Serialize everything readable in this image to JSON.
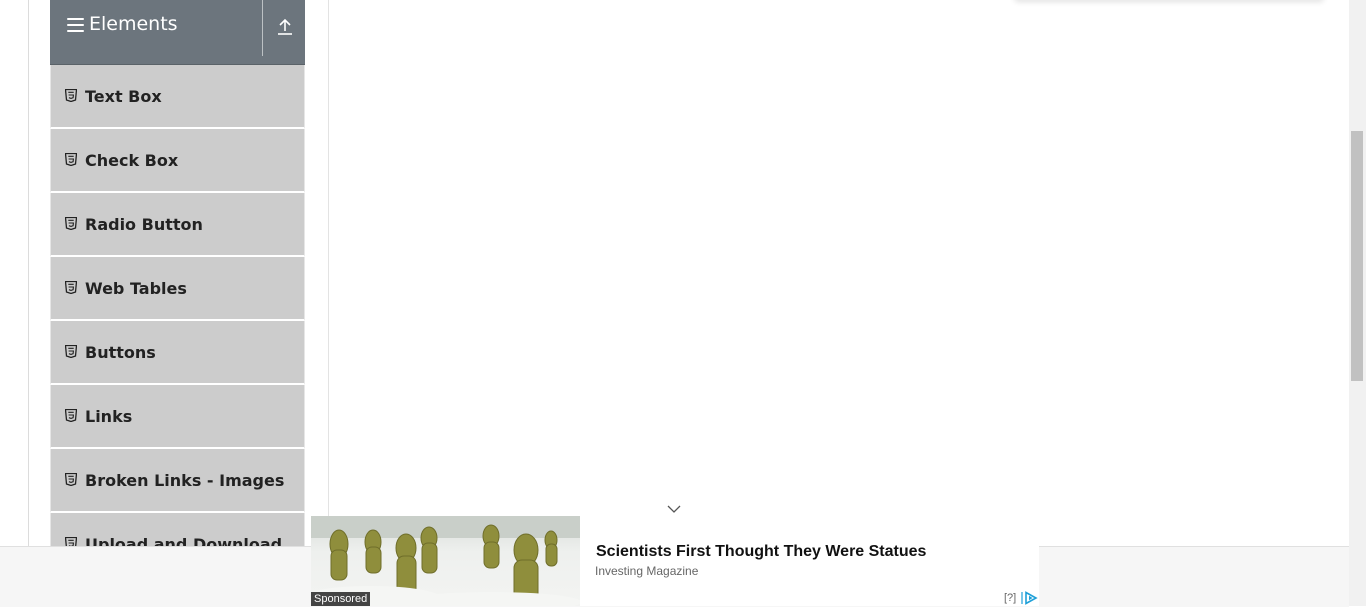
{
  "sidebar": {
    "group_title": "Elements",
    "items": [
      {
        "label": "Text Box"
      },
      {
        "label": "Check Box"
      },
      {
        "label": "Radio Button"
      },
      {
        "label": "Web Tables"
      },
      {
        "label": "Buttons"
      },
      {
        "label": "Links"
      },
      {
        "label": "Broken Links - Images"
      },
      {
        "label": "Upload and Download"
      }
    ]
  },
  "ad": {
    "headline": "Scientists First Thought They Were Statues",
    "source": "Investing Magazine",
    "sponsored_label": "Sponsored",
    "help_label": "[?]"
  },
  "colors": {
    "group_header": "#6c757d",
    "menu_item": "#cccccc",
    "ad_logo": "#1fa0d8"
  },
  "icons": {
    "group": "hamburger-menu-icon",
    "collapse": "upload-arrow-icon",
    "item": "html5-icon",
    "ad_expand": "chevron-down-icon",
    "ad_logo": "adchoices-icon"
  }
}
